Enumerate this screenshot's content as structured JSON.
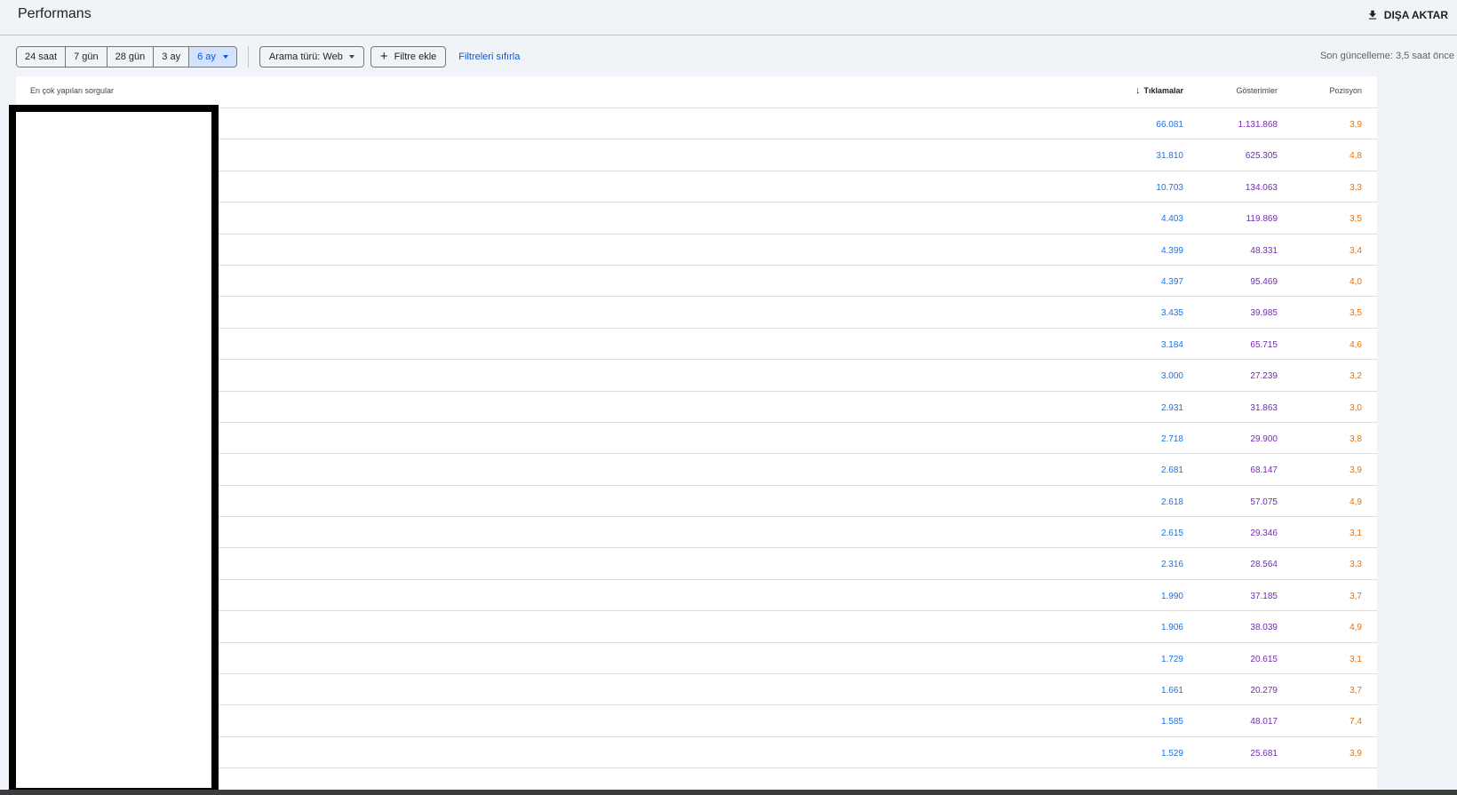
{
  "header": {
    "title": "Performans",
    "export_label": "DIŞA AKTAR"
  },
  "toolbar": {
    "date_ranges": [
      "24 saat",
      "7 gün",
      "28 gün",
      "3 ay",
      "6 ay"
    ],
    "active_range": "6 ay",
    "search_type_label": "Arama türü: Web",
    "add_filter_label": "Filtre ekle",
    "reset_filters_label": "Filtreleri sıfırla",
    "last_update": "Son güncelleme: 3,5 saat önce"
  },
  "table": {
    "columns": {
      "query": "En çok yapılan sorgular",
      "clicks": "Tıklamalar",
      "impressions": "Gösterimler",
      "position": "Pozisyon"
    },
    "rows": [
      {
        "clicks": "66.081",
        "impressions": "1.131.868",
        "position": "3,9"
      },
      {
        "clicks": "31.810",
        "impressions": "625.305",
        "position": "4,8"
      },
      {
        "clicks": "10.703",
        "impressions": "134.063",
        "position": "3,3"
      },
      {
        "clicks": "4.403",
        "impressions": "119.869",
        "position": "3,5"
      },
      {
        "clicks": "4.399",
        "impressions": "48.331",
        "position": "3,4"
      },
      {
        "clicks": "4.397",
        "impressions": "95.469",
        "position": "4,0"
      },
      {
        "clicks": "3.435",
        "impressions": "39.985",
        "position": "3,5"
      },
      {
        "clicks": "3.184",
        "impressions": "65.715",
        "position": "4,6"
      },
      {
        "clicks": "3.000",
        "impressions": "27.239",
        "position": "3,2"
      },
      {
        "clicks": "2.931",
        "impressions": "31.863",
        "position": "3,0"
      },
      {
        "clicks": "2.718",
        "impressions": "29.900",
        "position": "3,8"
      },
      {
        "clicks": "2.681",
        "impressions": "68.147",
        "position": "3,9"
      },
      {
        "clicks": "2.618",
        "impressions": "57.075",
        "position": "4,9"
      },
      {
        "clicks": "2.615",
        "impressions": "29.346",
        "position": "3,1"
      },
      {
        "clicks": "2.316",
        "impressions": "28.564",
        "position": "3,3"
      },
      {
        "clicks": "1.990",
        "impressions": "37.185",
        "position": "3,7"
      },
      {
        "clicks": "1.906",
        "impressions": "38.039",
        "position": "4,9"
      },
      {
        "clicks": "1.729",
        "impressions": "20.615",
        "position": "3,1"
      },
      {
        "clicks": "1.661",
        "impressions": "20.279",
        "position": "3,7"
      },
      {
        "clicks": "1.585",
        "impressions": "48.017",
        "position": "7,4"
      },
      {
        "clicks": "1.529",
        "impressions": "25.681",
        "position": "3,9"
      }
    ]
  },
  "colors": {
    "clicks": "#1a73e8",
    "impressions": "#7627bb",
    "position": "#e8710a",
    "active_range_bg": "#d3e3fd"
  },
  "icons": {
    "export": "download-icon",
    "sort": "arrow-down-icon",
    "add": "plus-icon",
    "dropdown": "caret-down-icon"
  }
}
